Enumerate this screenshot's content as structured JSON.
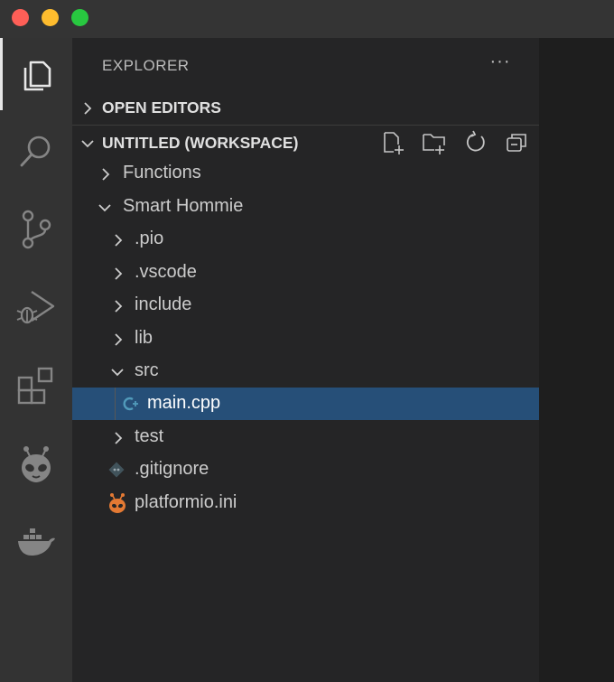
{
  "window": {
    "traffic_lights": [
      "close",
      "minimize",
      "zoom"
    ]
  },
  "activity_bar": {
    "items": [
      {
        "name": "explorer",
        "icon": "files-icon",
        "active": true
      },
      {
        "name": "search",
        "icon": "search-icon",
        "active": false
      },
      {
        "name": "source-control",
        "icon": "source-control-icon",
        "active": false
      },
      {
        "name": "run-debug",
        "icon": "run-debug-icon",
        "active": false
      },
      {
        "name": "extensions",
        "icon": "extensions-icon",
        "active": false
      },
      {
        "name": "platformio",
        "icon": "alien-icon",
        "active": false
      },
      {
        "name": "docker",
        "icon": "docker-icon",
        "active": false
      }
    ]
  },
  "sidebar": {
    "title": "EXPLORER",
    "more": "···",
    "open_editors": {
      "label": "OPEN EDITORS",
      "expanded": false
    },
    "workspace": {
      "label": "UNTITLED (WORKSPACE)",
      "expanded": true,
      "actions": [
        "new-file-icon",
        "new-folder-icon",
        "refresh-icon",
        "collapse-all-icon"
      ]
    },
    "tree": [
      {
        "label": "Functions",
        "type": "folder",
        "expanded": false
      },
      {
        "label": "Smart Hommie",
        "type": "folder",
        "expanded": true
      },
      {
        "label": ".pio",
        "type": "folder",
        "expanded": false
      },
      {
        "label": ".vscode",
        "type": "folder",
        "expanded": false
      },
      {
        "label": "include",
        "type": "folder",
        "expanded": false
      },
      {
        "label": "lib",
        "type": "folder",
        "expanded": false
      },
      {
        "label": "src",
        "type": "folder",
        "expanded": true
      },
      {
        "label": "main.cpp",
        "type": "file",
        "icon": "cpp-file-icon",
        "selected": true
      },
      {
        "label": "test",
        "type": "folder",
        "expanded": false
      },
      {
        "label": ".gitignore",
        "type": "file",
        "icon": "git-file-icon"
      },
      {
        "label": "platformio.ini",
        "type": "file",
        "icon": "platformio-file-icon"
      }
    ]
  },
  "colors": {
    "selection": "#264f78",
    "cpp_icon": "#519aba",
    "platformio_icon": "#e37933",
    "git_icon": "#41535b"
  }
}
